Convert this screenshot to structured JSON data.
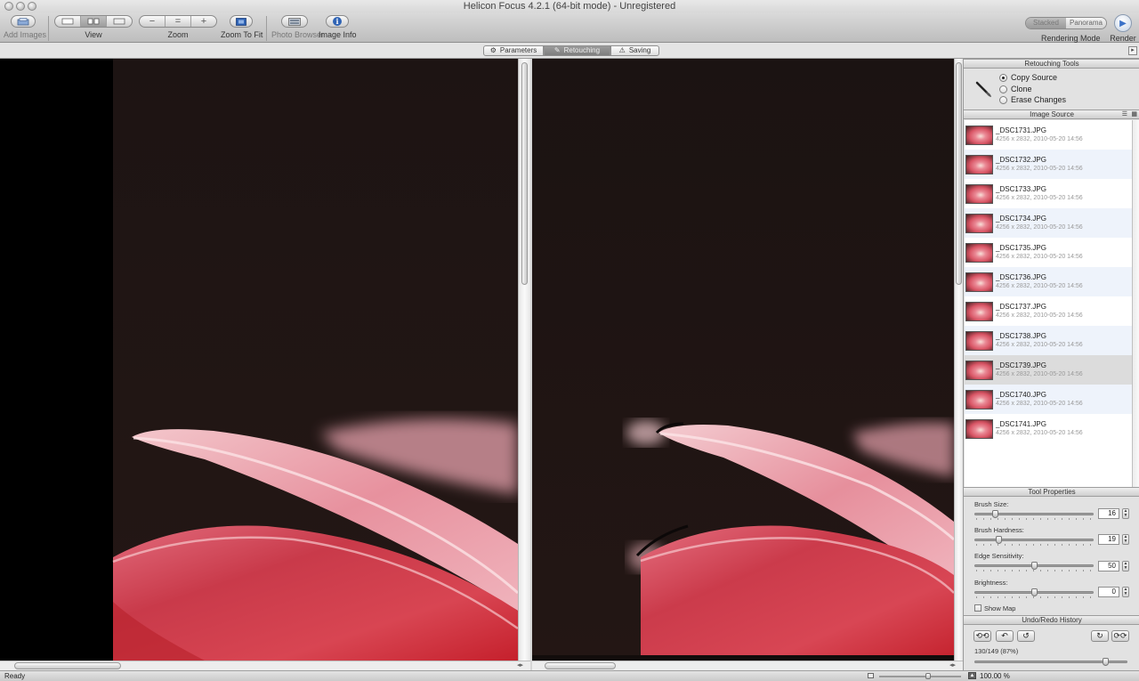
{
  "window": {
    "title": "Helicon Focus 4.2.1 (64-bit mode) - Unregistered"
  },
  "toolbar": {
    "add_images": "Add Images",
    "view": "View",
    "zoom": "Zoom",
    "zoom_minus": "−",
    "zoom_reset": "=",
    "zoom_plus": "+",
    "zoom_to_fit": "Zoom To Fit",
    "photo_browser": "Photo Browser",
    "image_info": "Image Info",
    "mode_stacked": "Stacked",
    "mode_panorama": "Panorama",
    "rendering_mode": "Rendering Mode",
    "render": "Render"
  },
  "tabs": {
    "parameters": "Parameters",
    "retouching": "Retouching",
    "saving": "Saving",
    "selected": "retouching"
  },
  "panel": {
    "retouching_tools": {
      "title": "Retouching Tools",
      "options": [
        "Copy Source",
        "Clone",
        "Erase Changes"
      ],
      "selected_index": 0
    },
    "image_source": {
      "title": "Image Source",
      "items": [
        {
          "name": "_DSC1731.JPG",
          "meta": "4256 x 2832, 2010-05-20 14:56"
        },
        {
          "name": "_DSC1732.JPG",
          "meta": "4256 x 2832, 2010-05-20 14:56"
        },
        {
          "name": "_DSC1733.JPG",
          "meta": "4256 x 2832, 2010-05-20 14:56"
        },
        {
          "name": "_DSC1734.JPG",
          "meta": "4256 x 2832, 2010-05-20 14:56"
        },
        {
          "name": "_DSC1735.JPG",
          "meta": "4256 x 2832, 2010-05-20 14:56"
        },
        {
          "name": "_DSC1736.JPG",
          "meta": "4256 x 2832, 2010-05-20 14:56"
        },
        {
          "name": "_DSC1737.JPG",
          "meta": "4256 x 2832, 2010-05-20 14:56"
        },
        {
          "name": "_DSC1738.JPG",
          "meta": "4256 x 2832, 2010-05-20 14:56"
        },
        {
          "name": "_DSC1739.JPG",
          "meta": "4256 x 2832, 2010-05-20 14:56"
        },
        {
          "name": "_DSC1740.JPG",
          "meta": "4256 x 2832, 2010-05-20 14:56"
        },
        {
          "name": "_DSC1741.JPG",
          "meta": "4256 x 2832, 2010-05-20 14:56"
        }
      ],
      "highlighted_index": 8
    },
    "tool_properties": {
      "title": "Tool Properties",
      "brush_size": {
        "label": "Brush Size:",
        "value": "16",
        "fraction": 0.16
      },
      "brush_hardness": {
        "label": "Brush Hardness:",
        "value": "19",
        "fraction": 0.19
      },
      "edge_sensitivity": {
        "label": "Edge Sensitivity:",
        "value": "50",
        "fraction": 0.5
      },
      "brightness": {
        "label": "Brightness:",
        "value": "0",
        "fraction": 0.5
      },
      "show_map": {
        "label": "Show Map",
        "checked": false
      }
    },
    "history": {
      "title": "Undo/Redo History",
      "position": "130/149 (87%)",
      "fraction": 0.87
    }
  },
  "statusbar": {
    "status": "Ready",
    "zoom_percent": "100.00 %",
    "zoom_slider_fraction": 0.6
  },
  "colors": {
    "accent": "#3b72c8",
    "selection_row": "#dcdcdc",
    "alt_row": "#eef3fb",
    "background": "#1c1414"
  },
  "icons": {
    "add_images": "add-images-icon",
    "zoom_to_fit": "zoom-to-fit-icon",
    "photo_browser": "photo-browser-icon",
    "image_info": "info-icon",
    "render": "play-icon",
    "brush": "brush-icon"
  }
}
